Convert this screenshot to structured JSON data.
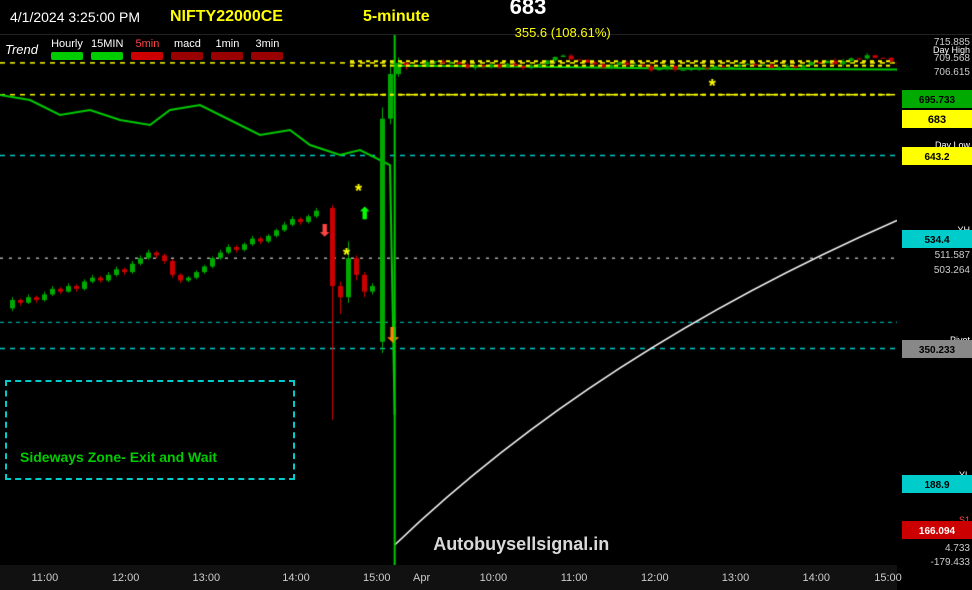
{
  "header": {
    "datetime": "4/1/2024 3:25:00 PM",
    "symbol": "NIFTY22000CE",
    "timeframe": "5-minute",
    "price": "683",
    "change": "355.6 (108.61%)"
  },
  "toolbar": {
    "trend_label": "Trend",
    "items": [
      {
        "label": "Hourly",
        "color": "green"
      },
      {
        "label": "15MIN",
        "color": "green"
      },
      {
        "label": "5min",
        "color": "red"
      },
      {
        "label": "macd",
        "color": "red"
      },
      {
        "label": "1min",
        "color": "darkred"
      },
      {
        "label": "3min",
        "color": "darkred"
      }
    ]
  },
  "price_levels": {
    "day_high": {
      "label": "Day High",
      "value": "715.885"
    },
    "p2": {
      "value": "709.568"
    },
    "p3": {
      "value": "706.615"
    },
    "p4": {
      "value": "695.733"
    },
    "current": {
      "value": "683"
    },
    "day_low_label": "Day Low",
    "day_low": {
      "value": "643.2"
    },
    "yh": {
      "label": "YH",
      "value": "534.4"
    },
    "r1": {
      "value": "511.587"
    },
    "p5": {
      "value": "503.264"
    },
    "pivot": {
      "label": "Pivot",
      "value": "350.233"
    },
    "yl": {
      "label": "YL",
      "value": "188.9"
    },
    "s1": {
      "label": "S1",
      "value": "166.094"
    },
    "p6": {
      "value": "4.733"
    },
    "p7": {
      "value": "-179.433"
    }
  },
  "sideways": {
    "text": "Sideways Zone- Exit and Wait"
  },
  "watermark": {
    "text": "Autobuysellsignal.in"
  },
  "time_ticks": {
    "left_side": [
      "11:00",
      "12:00",
      "13:00",
      "14:00",
      "15:00"
    ],
    "right_side": [
      "Apr",
      "10:00",
      "11:00",
      "12:00",
      "13:00",
      "14:00",
      "15:00"
    ]
  },
  "colors": {
    "background": "#000000",
    "green": "#00cc00",
    "red": "#cc0000",
    "yellow": "#ffff00",
    "cyan": "#00cccc",
    "white": "#ffffff"
  }
}
